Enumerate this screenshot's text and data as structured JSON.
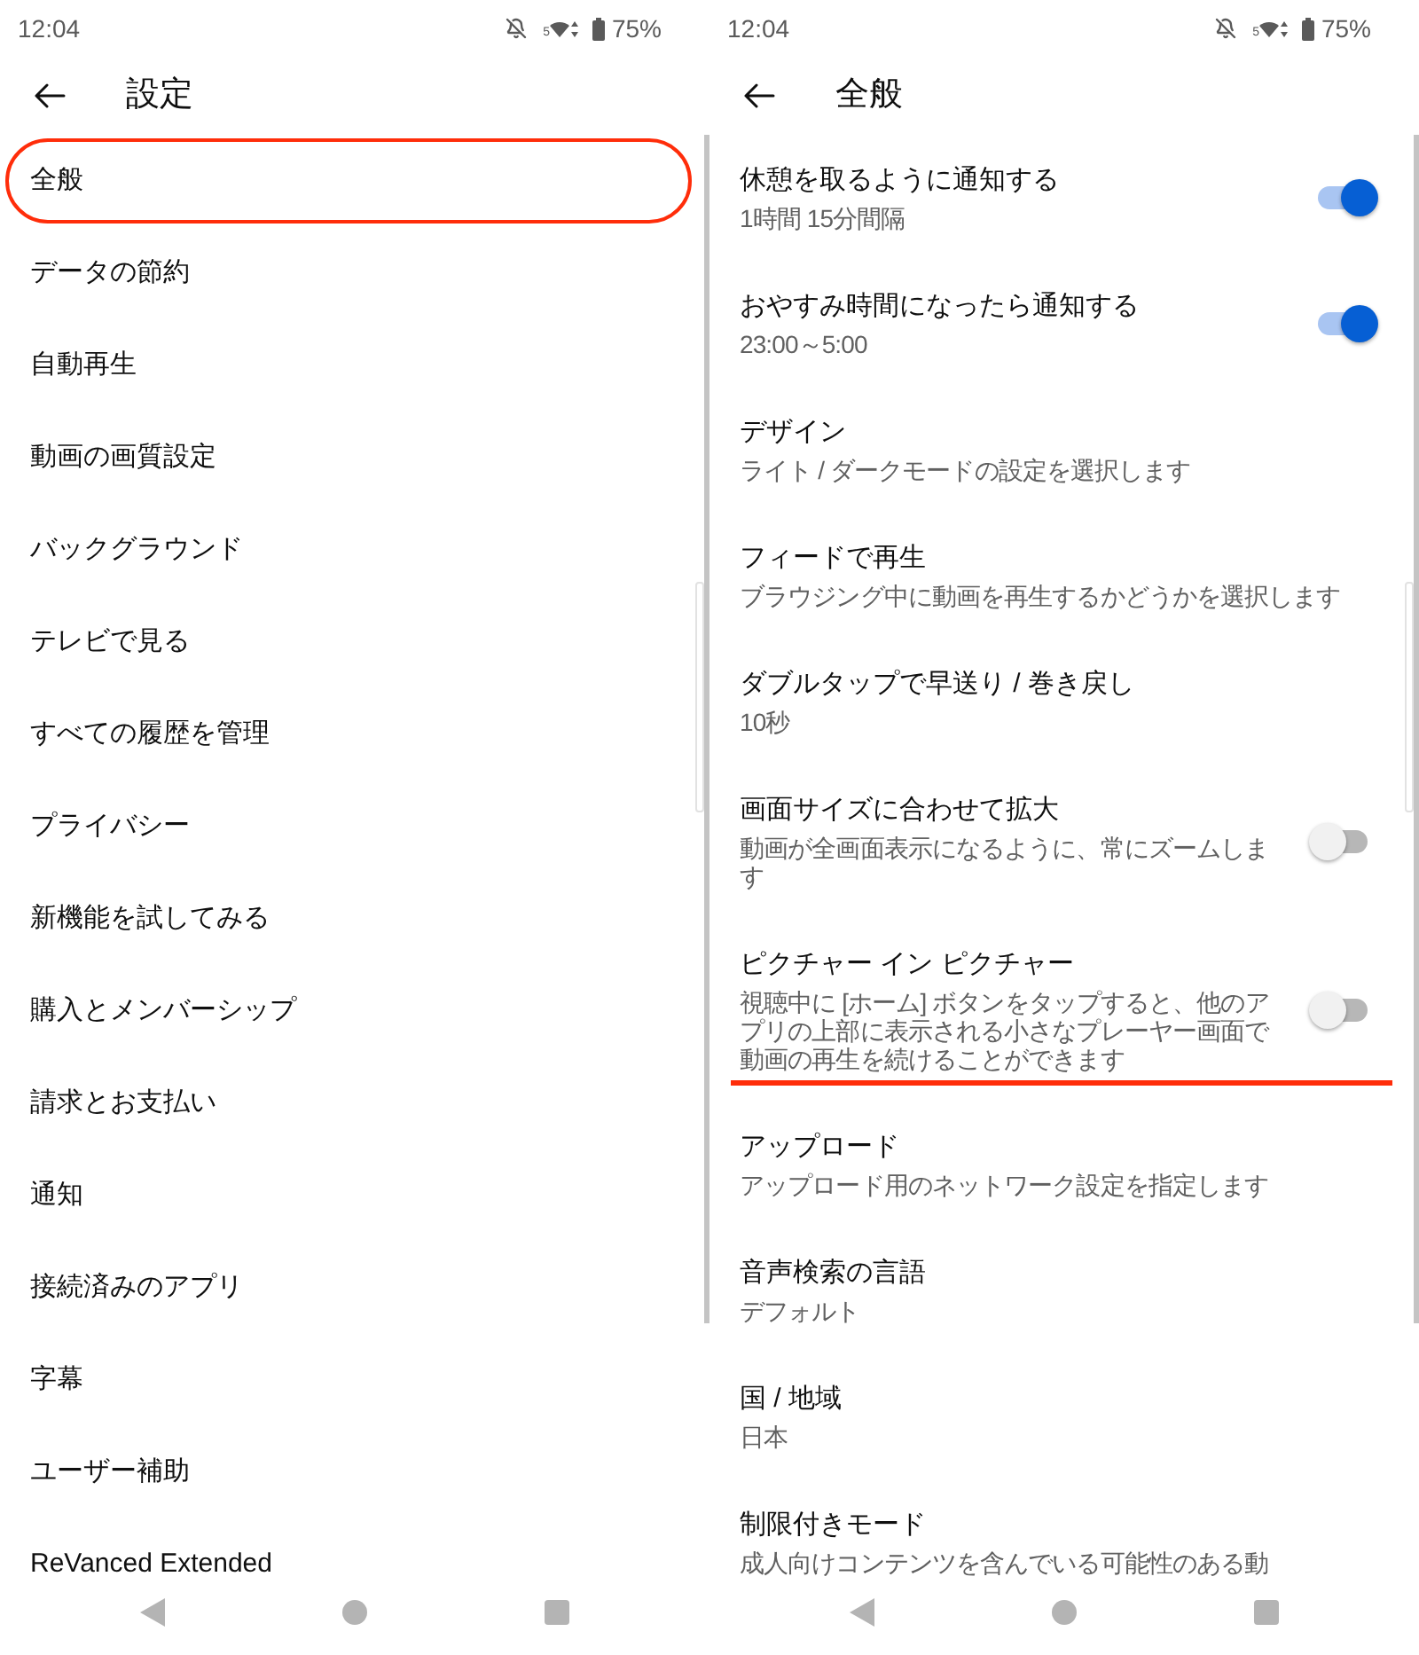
{
  "panels": [
    {
      "status_bar": {
        "time": "12:04",
        "wifi_band": "5",
        "battery": "75%"
      },
      "header": {
        "title": "設定"
      },
      "items": [
        {
          "title": "全般",
          "circled": true
        },
        {
          "title": "データの節約",
          "circled": false
        },
        {
          "title": "自動再生",
          "circled": false
        },
        {
          "title": "動画の画質設定",
          "circled": false
        },
        {
          "title": "バックグラウンド",
          "circled": false
        },
        {
          "title": "テレビで見る",
          "circled": false
        },
        {
          "title": "すべての履歴を管理",
          "circled": false
        },
        {
          "title": "プライバシー",
          "circled": false
        },
        {
          "title": "新機能を試してみる",
          "circled": false
        },
        {
          "title": "購入とメンバーシップ",
          "circled": false
        },
        {
          "title": "請求とお支払い",
          "circled": false
        },
        {
          "title": "通知",
          "circled": false
        },
        {
          "title": "接続済みのアプリ",
          "circled": false
        },
        {
          "title": "字幕",
          "circled": false
        },
        {
          "title": "ユーザー補助",
          "circled": false
        },
        {
          "title": "ReVanced Extended",
          "circled": false
        }
      ]
    },
    {
      "status_bar": {
        "time": "12:04",
        "wifi_band": "5",
        "battery": "75%"
      },
      "header": {
        "title": "全般"
      },
      "items": [
        {
          "kind": "toggle",
          "title": "休憩を取るように通知する",
          "subtitle": "1時間 15分間隔",
          "on": true,
          "underlined": false
        },
        {
          "kind": "toggle",
          "title": "おやすみ時間になったら通知する",
          "subtitle": "23:00～5:00",
          "on": true,
          "underlined": false
        },
        {
          "kind": "link",
          "title": "デザイン",
          "subtitle": "ライト / ダークモードの設定を選択します",
          "underlined": false
        },
        {
          "kind": "link",
          "title": "フィードで再生",
          "subtitle": "ブラウジング中に動画を再生するかどうかを選択します",
          "underlined": false
        },
        {
          "kind": "link",
          "title": "ダブルタップで早送り / 巻き戻し",
          "subtitle": "10秒",
          "underlined": false
        },
        {
          "kind": "toggle",
          "title": "画面サイズに合わせて拡大",
          "subtitle": "動画が全画面表示になるように、常にズームします",
          "on": false,
          "underlined": false
        },
        {
          "kind": "toggle",
          "title": "ピクチャー イン ピクチャー",
          "subtitle": "視聴中に [ホーム] ボタンをタップすると、他のアプリの上部に表示される小さなプレーヤー画面で動画の再生を続けることができます",
          "on": false,
          "underlined": true
        },
        {
          "kind": "link",
          "title": "アップロード",
          "subtitle": "アップロード用のネットワーク設定を指定します",
          "underlined": false
        },
        {
          "kind": "link",
          "title": "音声検索の言語",
          "subtitle": "デフォルト",
          "underlined": false
        },
        {
          "kind": "link",
          "title": "国 / 地域",
          "subtitle": "日本",
          "underlined": false
        },
        {
          "kind": "link",
          "title": "制限付きモード",
          "subtitle": "成人向けコンテンツを含んでいる可能性のある動",
          "underlined": false
        }
      ]
    }
  ]
}
